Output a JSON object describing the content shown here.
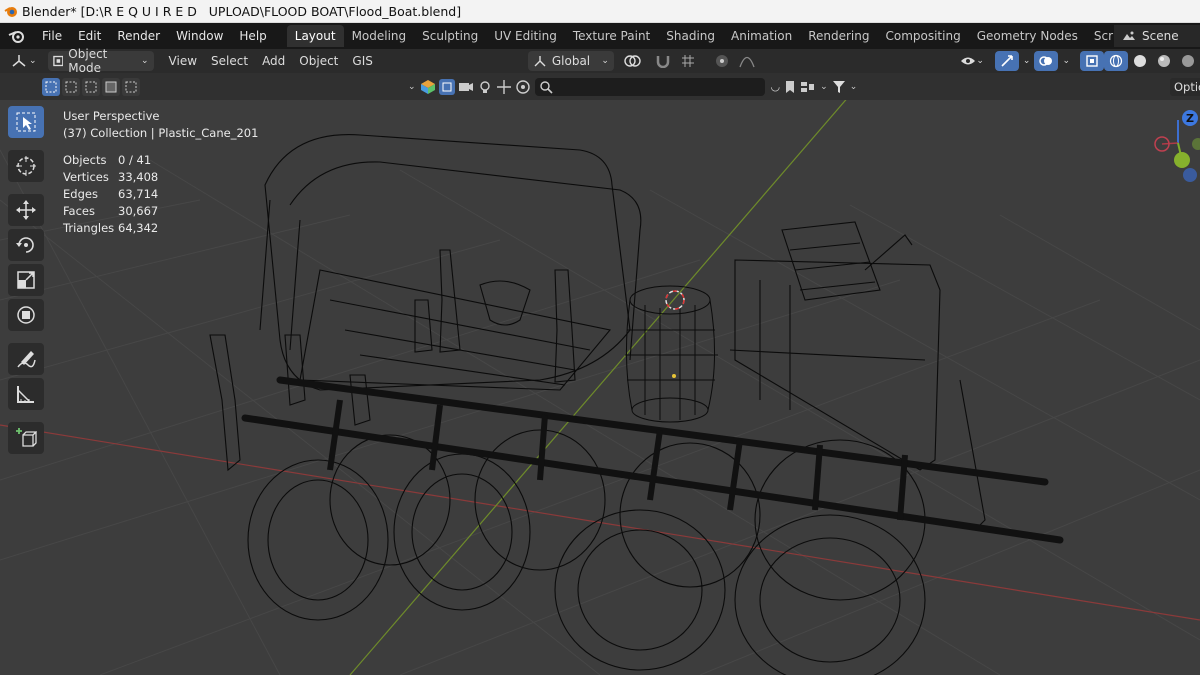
{
  "titlebar": {
    "title": "Blender* [D:\\R E Q U I R E D   UPLOAD\\FLOOD BOAT\\Flood_Boat.blend]"
  },
  "menu": {
    "file": "File",
    "edit": "Edit",
    "render": "Render",
    "window": "Window",
    "help": "Help"
  },
  "workspaces": [
    "Layout",
    "Modeling",
    "Sculpting",
    "UV Editing",
    "Texture Paint",
    "Shading",
    "Animation",
    "Rendering",
    "Compositing",
    "Geometry Nodes",
    "Scripting"
  ],
  "active_workspace": "Layout",
  "scene": {
    "label": "Scene"
  },
  "header": {
    "mode": "Object Mode",
    "view": "View",
    "select": "Select",
    "add": "Add",
    "object": "Object",
    "gis": "GIS",
    "transform_orientation": "Global"
  },
  "options": {
    "label": "Optio"
  },
  "viewport_info": {
    "perspective": "User Perspective",
    "collection": "(37) Collection | Plastic_Cane_201",
    "stats": [
      {
        "label": "Objects",
        "value": "0 / 41"
      },
      {
        "label": "Vertices",
        "value": "33,408"
      },
      {
        "label": "Edges",
        "value": "63,714"
      },
      {
        "label": "Faces",
        "value": "30,667"
      },
      {
        "label": "Triangles",
        "value": "64,342"
      }
    ]
  },
  "tools": [
    "select-box-icon",
    "cursor-icon",
    "move-icon",
    "rotate-icon",
    "scale-icon",
    "transform-icon",
    "annotate-icon",
    "measure-icon",
    "add-cube-icon"
  ],
  "gizmo": {
    "z": "Z"
  },
  "colors": {
    "accent": "#4772b3",
    "x_axis": "#8b3a3a",
    "y_axis": "#6e8b2a",
    "grid": "#474747",
    "wire": "#0b0b0b"
  }
}
